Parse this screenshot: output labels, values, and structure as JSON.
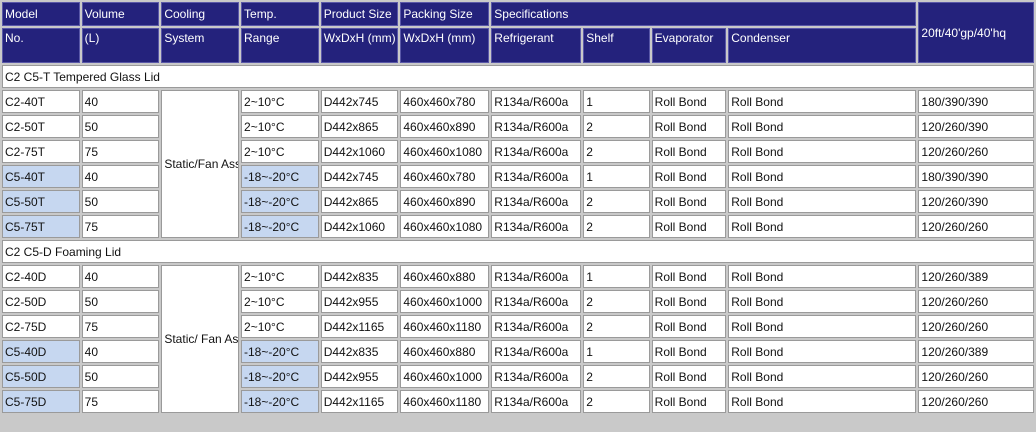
{
  "header": {
    "row1": [
      "Model",
      "Volume",
      "Cooling",
      "Temp.",
      "Product Size",
      "Packing Size",
      "Specifications"
    ],
    "row2": [
      "No.",
      "(L)",
      "System",
      "Range",
      "WxDxH (mm)",
      "WxDxH (mm)",
      "Refrigerant",
      "Shelf",
      "Evaporator",
      "Condenser"
    ],
    "container": "20ft/40'gp/40'hq"
  },
  "sections": [
    {
      "title": "C2 C5-T Tempered Glass Lid",
      "cooling": "Static/Fan Assisted Cooling",
      "rows": [
        {
          "model": "C2-40T",
          "volume": "40",
          "temp": "2~10°C",
          "product": "D442x745",
          "packing": "460x460x780",
          "refrigerant": "R134a/R600a",
          "shelf": "1",
          "evaporator": "Roll Bond",
          "condenser": "Roll Bond",
          "container": "180/390/390"
        },
        {
          "model": "C2-50T",
          "volume": "50",
          "temp": "2~10°C",
          "product": "D442x865",
          "packing": "460x460x890",
          "refrigerant": "R134a/R600a",
          "shelf": "2",
          "evaporator": "Roll Bond",
          "condenser": "Roll Bond",
          "container": "120/260/390"
        },
        {
          "model": "C2-75T",
          "volume": "75",
          "temp": "2~10°C",
          "product": "D442x1060",
          "packing": "460x460x1080",
          "refrigerant": "R134a/R600a",
          "shelf": "2",
          "evaporator": "Roll Bond",
          "condenser": "Roll Bond",
          "container": "120/260/260"
        },
        {
          "model": "C5-40T",
          "volume": "40",
          "temp": "-18~-20°C",
          "product": "D442x745",
          "packing": "460x460x780",
          "refrigerant": "R134a/R600a",
          "shelf": "1",
          "evaporator": "Roll Bond",
          "condenser": "Roll Bond",
          "container": "180/390/390"
        },
        {
          "model": "C5-50T",
          "volume": "50",
          "temp": "-18~-20°C",
          "product": "D442x865",
          "packing": "460x460x890",
          "refrigerant": "R134a/R600a",
          "shelf": "2",
          "evaporator": "Roll Bond",
          "condenser": "Roll Bond",
          "container": "120/260/390"
        },
        {
          "model": "C5-75T",
          "volume": "75",
          "temp": "-18~-20°C",
          "product": "D442x1060",
          "packing": "460x460x1080",
          "refrigerant": "R134a/R600a",
          "shelf": "2",
          "evaporator": "Roll Bond",
          "condenser": "Roll Bond",
          "container": "120/260/260"
        }
      ]
    },
    {
      "title": "C2 C5-D  Foaming Lid",
      "cooling": "Static/ Fan Assisted Cooling",
      "rows": [
        {
          "model": "C2-40D",
          "volume": "40",
          "temp": "2~10°C",
          "product": "D442x835",
          "packing": "460x460x880",
          "refrigerant": "R134a/R600a",
          "shelf": "1",
          "evaporator": "Roll Bond",
          "condenser": "Roll Bond",
          "container": "120/260/389"
        },
        {
          "model": "C2-50D",
          "volume": "50",
          "temp": "2~10°C",
          "product": "D442x955",
          "packing": "460x460x1000",
          "refrigerant": "R134a/R600a",
          "shelf": "2",
          "evaporator": "Roll Bond",
          "condenser": "Roll Bond",
          "container": "120/260/260"
        },
        {
          "model": "C2-75D",
          "volume": "75",
          "temp": "2~10°C",
          "product": "D442x1165",
          "packing": "460x460x1180",
          "refrigerant": "R134a/R600a",
          "shelf": "2",
          "evaporator": "Roll Bond",
          "condenser": "Roll Bond",
          "container": "120/260/260"
        },
        {
          "model": "C5-40D",
          "volume": "40",
          "temp": "-18~-20°C",
          "product": "D442x835",
          "packing": "460x460x880",
          "refrigerant": "R134a/R600a",
          "shelf": "1",
          "evaporator": "Roll Bond",
          "condenser": "Roll Bond",
          "container": "120/260/389"
        },
        {
          "model": "C5-50D",
          "volume": "50",
          "temp": "-18~-20°C",
          "product": "D442x955",
          "packing": "460x460x1000",
          "refrigerant": "R134a/R600a",
          "shelf": "2",
          "evaporator": "Roll Bond",
          "condenser": "Roll Bond",
          "container": "120/260/260"
        },
        {
          "model": "C5-75D",
          "volume": "75",
          "temp": "-18~-20°C",
          "product": "D442x1165",
          "packing": "460x460x1180",
          "refrigerant": "R134a/R600a",
          "shelf": "2",
          "evaporator": "Roll Bond",
          "condenser": "Roll Bond",
          "container": "120/260/260"
        }
      ]
    }
  ],
  "colors": {
    "header_bg": "#24227c",
    "highlight": "#c6d7f0",
    "grid": "#c9c9c9"
  }
}
